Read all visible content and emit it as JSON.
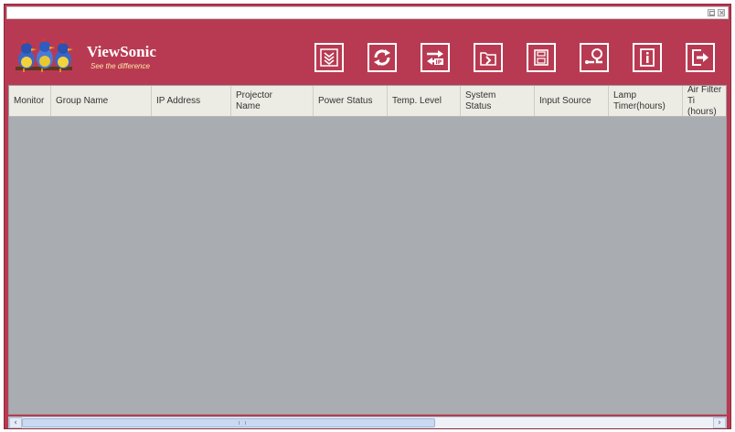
{
  "brand": {
    "name": "ViewSonic",
    "tagline": "See the difference"
  },
  "toolbar": {
    "buttons": [
      {
        "name": "scan-icon"
      },
      {
        "name": "refresh-icon"
      },
      {
        "name": "change-ip-icon"
      },
      {
        "name": "import-icon"
      },
      {
        "name": "save-icon"
      },
      {
        "name": "settings-icon"
      },
      {
        "name": "info-icon"
      },
      {
        "name": "exit-icon"
      }
    ]
  },
  "table": {
    "columns": [
      "Monitor",
      "Group Name",
      "IP Address",
      "Projector\nName",
      "Power Status",
      "Temp. Level",
      "System\nStatus",
      "Input Source",
      "Lamp\nTimer(hours)",
      "Air Filter Ti\n(hours)"
    ]
  },
  "colors": {
    "frame": "#b83a52",
    "table_bg": "#a9acb1",
    "header_bg": "#ecebe4"
  }
}
